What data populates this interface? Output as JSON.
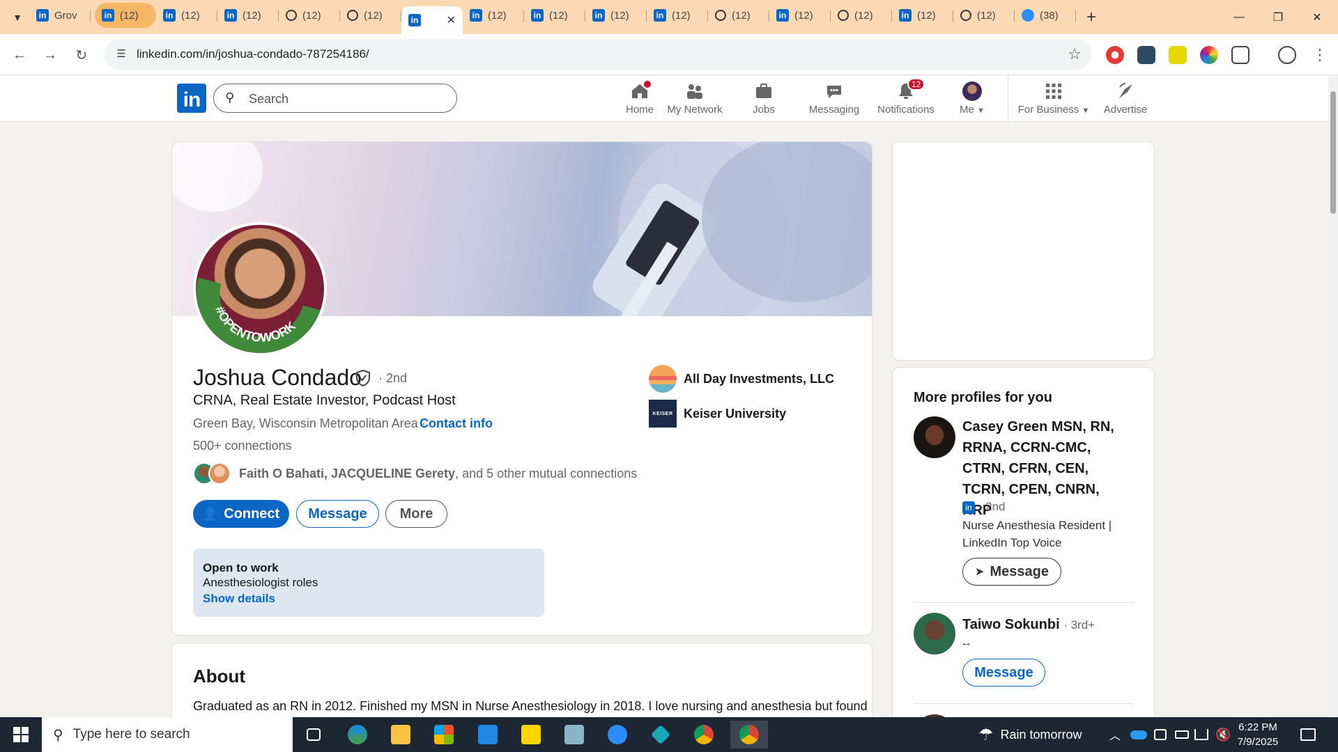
{
  "browser": {
    "tabs": [
      {
        "label": "Grov",
        "icon": "linkedin"
      },
      {
        "label": "(12)",
        "icon": "linkedin",
        "highlight": true
      },
      {
        "label": "(12)",
        "icon": "linkedin"
      },
      {
        "label": "(12)",
        "icon": "linkedin"
      },
      {
        "label": "(12)",
        "icon": "ring"
      },
      {
        "label": "(12)",
        "icon": "ring"
      },
      {
        "label": "",
        "icon": "linkedin",
        "active": true
      },
      {
        "label": "(12)",
        "icon": "linkedin"
      },
      {
        "label": "(12)",
        "icon": "linkedin"
      },
      {
        "label": "(12)",
        "icon": "linkedin"
      },
      {
        "label": "(12)",
        "icon": "linkedin"
      },
      {
        "label": "(12)",
        "icon": "ring"
      },
      {
        "label": "(12)",
        "icon": "linkedin"
      },
      {
        "label": "(12)",
        "icon": "ring"
      },
      {
        "label": "(12)",
        "icon": "linkedin"
      },
      {
        "label": "(12)",
        "icon": "ring"
      },
      {
        "label": "(38)",
        "icon": "zoom"
      }
    ],
    "url": "linkedin.com/in/joshua-condado-787254186/"
  },
  "linkedin": {
    "logo": "in",
    "search_placeholder": "Search",
    "nav": {
      "home": "Home",
      "network": "My Network",
      "jobs": "Jobs",
      "messaging": "Messaging",
      "notifications": "Notifications",
      "notifications_badge": "12",
      "me": "Me",
      "business": "For Business",
      "advertise": "Advertise"
    }
  },
  "profile": {
    "name": "Joshua Condado",
    "degree": "· 2nd",
    "headline": "CRNA, Real Estate Investor, Podcast Host",
    "location": "Green Bay, Wisconsin Metropolitan Area ·",
    "contact_info": "Contact info",
    "connections": "500+ connections",
    "mutual_names": "Faith O Bahati, JACQUELINE Gerety",
    "mutual_suffix": ", and 5 other mutual connections",
    "avatar_ring_text": "#OPENTOWORK",
    "buttons": {
      "connect": "Connect",
      "message": "Message",
      "more": "More"
    },
    "companies": [
      {
        "name": "All Day Investments, LLC"
      },
      {
        "name": "Keiser University",
        "logo_text": "KEISER"
      }
    ],
    "open_to_work": {
      "title": "Open to work",
      "roles": "Anesthesiologist roles",
      "link": "Show details"
    }
  },
  "about": {
    "title": "About",
    "text": "Graduated as an RN in 2012. Finished my MSN in Nurse Anesthesiology in 2018. I love nursing and anesthesia but found"
  },
  "rail": {
    "title": "More profiles for you",
    "people": [
      {
        "name": "Casey Green MSN, RN, RRNA, CCRN-CMC, CTRN, CFRN, CEN, TCRN, CPEN, CNRN, NRP",
        "degree": "· 2nd",
        "headline": "Nurse Anesthesia Resident | LinkedIn Top Voice",
        "button": "Message"
      },
      {
        "name": "Taiwo Sokunbi",
        "degree": "· 3rd+",
        "headline": "--",
        "button": "Message"
      }
    ]
  },
  "taskbar": {
    "search_placeholder": "Type here to search",
    "weather": "Rain tomorrow",
    "time": "6:22 PM",
    "date": "7/9/2025"
  }
}
